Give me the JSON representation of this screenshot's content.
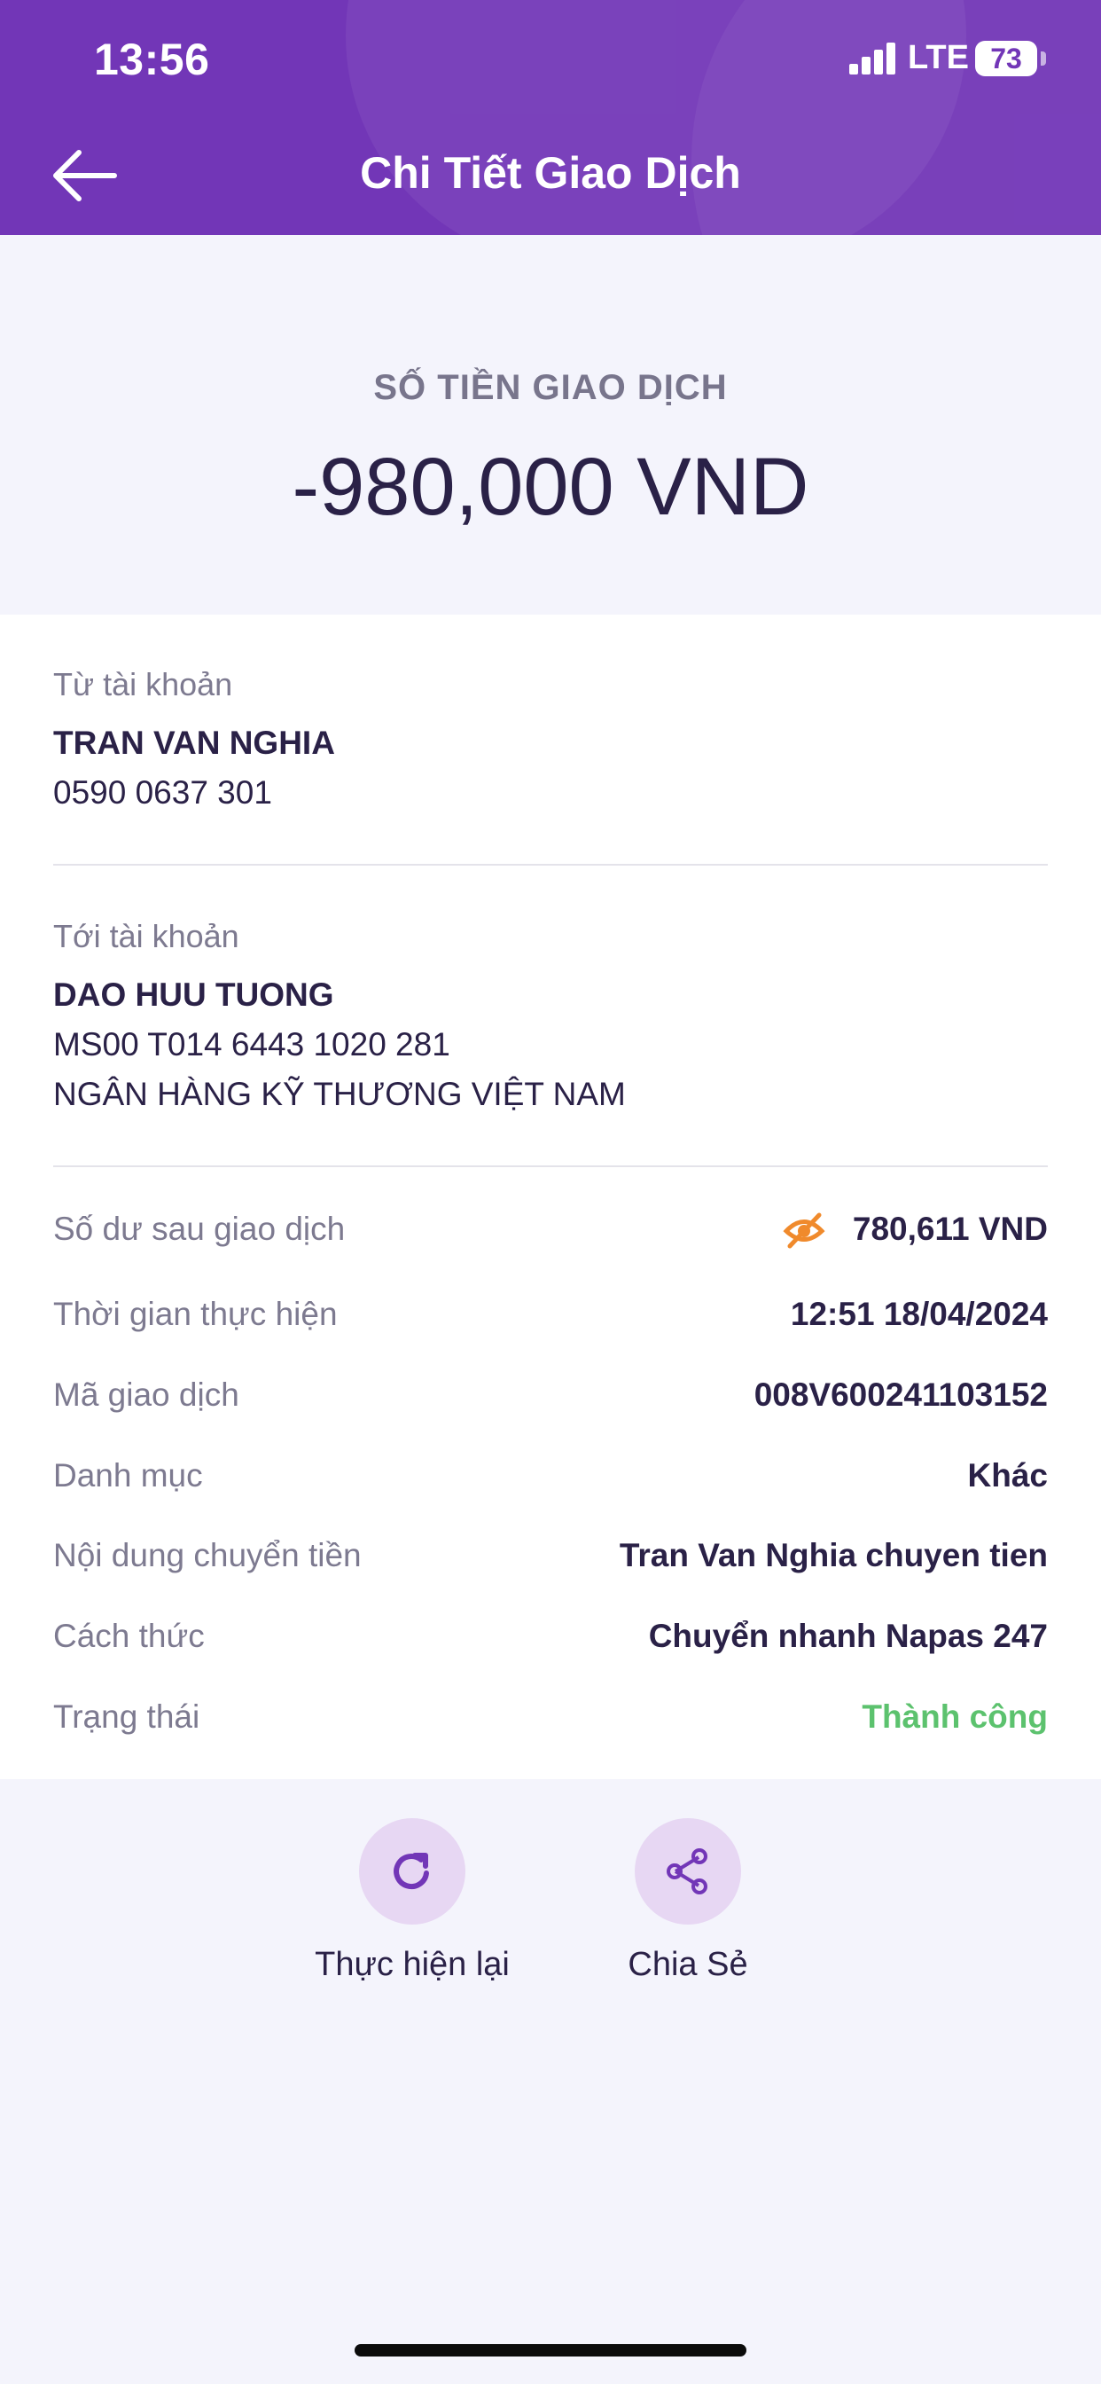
{
  "status_bar": {
    "time": "13:56",
    "network": "LTE",
    "battery": "73"
  },
  "header": {
    "title": "Chi Tiết Giao Dịch",
    "back_icon": "arrow-left-icon"
  },
  "amount": {
    "label": "SỐ TIỀN GIAO DỊCH",
    "value": "-980,000 VND"
  },
  "from_account": {
    "label": "Từ tài khoản",
    "name": "TRAN VAN NGHIA",
    "number": "0590 0637 301"
  },
  "to_account": {
    "label": "Tới tài khoản",
    "name": "DAO HUU TUONG",
    "number": "MS00 T014 6443 1020 281",
    "bank": "NGÂN HÀNG KỸ THƯƠNG VIỆT NAM"
  },
  "details": [
    {
      "label": "Số dư sau giao dịch",
      "value": "780,611 VND"
    },
    {
      "label": "Thời gian thực hiện",
      "value": "12:51 18/04/2024"
    },
    {
      "label": "Mã giao dịch",
      "value": "008V600241103152"
    },
    {
      "label": "Danh mục",
      "value": "Khác"
    },
    {
      "label": "Nội dung chuyển tiền",
      "value": "Tran Van Nghia chuyen tien"
    },
    {
      "label": "Cách thức",
      "value": "Chuyển nhanh Napas 247"
    },
    {
      "label": "Trạng thái",
      "value": "Thành công"
    }
  ],
  "actions": {
    "repeat": {
      "label": "Thực hiện lại",
      "icon": "refresh-icon"
    },
    "share": {
      "label": "Chia Sẻ",
      "icon": "share-icon"
    }
  },
  "colors": {
    "header_bg": "#7236b7",
    "success": "#5cc26e",
    "eye_icon": "#f08a2c",
    "action_circle": "#e7d7f3"
  }
}
